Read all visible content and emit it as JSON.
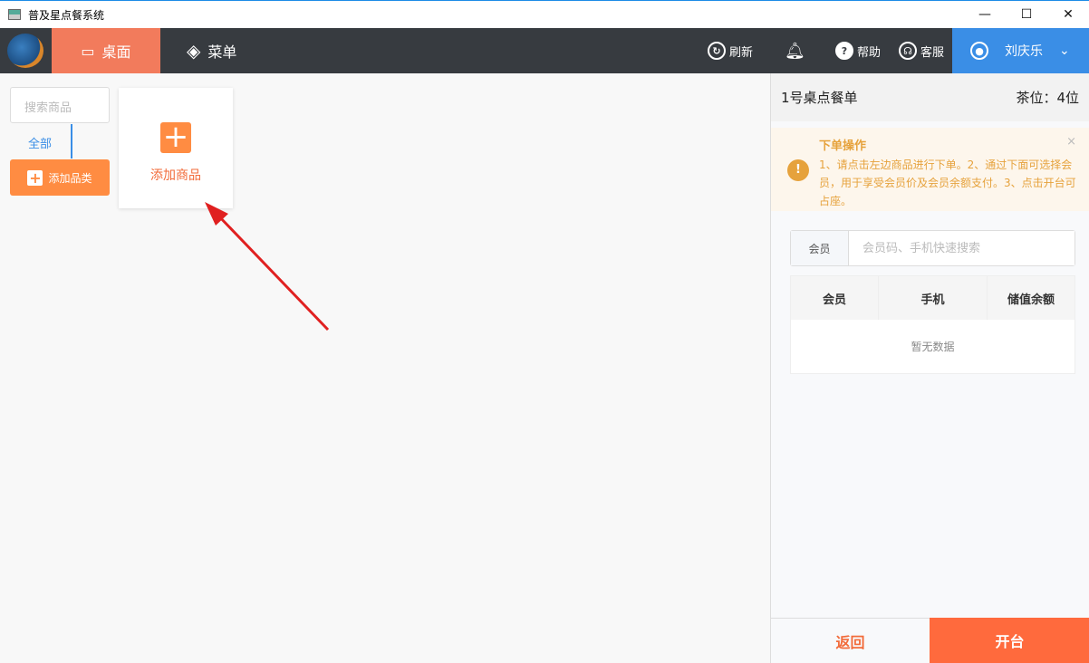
{
  "window": {
    "title": "普及星点餐系统",
    "min": "—",
    "max": "☐",
    "close": "✕"
  },
  "nav": {
    "home": "桌面",
    "menu": "菜单",
    "refresh": "刷新",
    "help": "帮助",
    "service": "客服",
    "user": "刘庆乐"
  },
  "left": {
    "search_placeholder": "搜索商品",
    "all": "全部",
    "add_category": "添加品类",
    "add_goods": "添加商品"
  },
  "order": {
    "title": "1号桌点餐单",
    "seats": "茶位：4位",
    "alert": {
      "title": "下单操作",
      "text": "1、请点击左边商品进行下单。2、通过下面可选择会员，用于享受会员价及会员余额支付。3、点击开台可占座。"
    },
    "member_label": "会员",
    "member_placeholder": "会员码、手机快速搜索",
    "columns": [
      "会员",
      "手机",
      "储值余额"
    ],
    "empty": "暂无数据",
    "back": "返回",
    "open": "开台"
  },
  "colors": {
    "accent": "#ff6a3d",
    "nav": "#373b40",
    "blue": "#3a8ee6"
  }
}
